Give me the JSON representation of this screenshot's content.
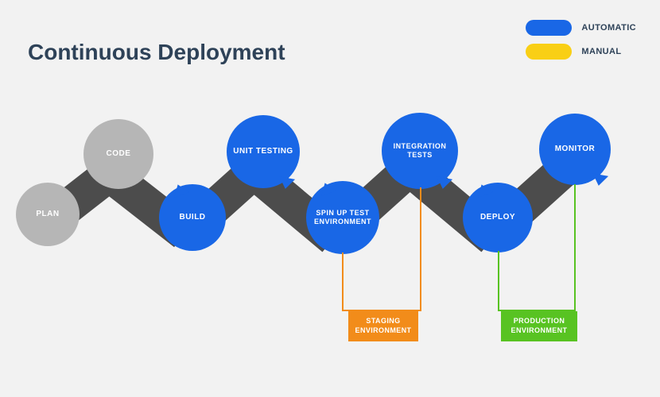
{
  "title": "Continuous Deployment",
  "legend": {
    "automatic": {
      "label": "AUTOMATIC",
      "color": "#1967e6"
    },
    "manual": {
      "label": "MANUAL",
      "color": "#f9cf15"
    }
  },
  "colors": {
    "gray_bubble": "#b6b6b6",
    "blue_bubble": "#1967e6",
    "connector": "#4c4c4c",
    "staging": "#f28c1a",
    "production": "#58c322"
  },
  "nodes": {
    "plan": {
      "label": "PLAN",
      "type": "manual_phase"
    },
    "code": {
      "label": "CODE",
      "type": "manual_phase"
    },
    "build": {
      "label": "BUILD",
      "type": "automatic"
    },
    "unit_testing": {
      "label": "UNIT TESTING",
      "type": "automatic"
    },
    "spin_up": {
      "label": "SPIN UP TEST ENVIRONMENT",
      "type": "automatic"
    },
    "integration": {
      "label": "INTEGRATION TESTS",
      "type": "automatic"
    },
    "deploy": {
      "label": "DEPLOY",
      "type": "automatic"
    },
    "monitor": {
      "label": "MONITOR",
      "type": "automatic"
    }
  },
  "environments": {
    "staging": {
      "label": "STAGING ENVIRONMENT",
      "color": "#f28c1a"
    },
    "production": {
      "label": "PRODUCTION ENVIRONMENT",
      "color": "#58c322"
    }
  }
}
